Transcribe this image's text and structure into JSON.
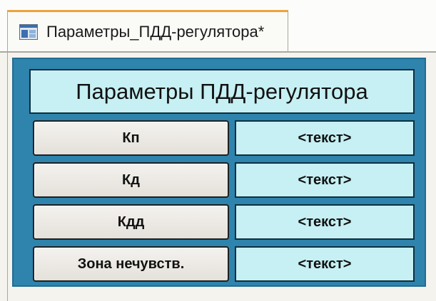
{
  "tab": {
    "title": "Параметры_ПДД-регулятора*",
    "icon": "screen-form-icon"
  },
  "panel": {
    "title": "Параметры ПДД-регулятора",
    "rows": [
      {
        "label": "Кп",
        "value": "<текст>"
      },
      {
        "label": "Кд",
        "value": "<текст>"
      },
      {
        "label": "Кдд",
        "value": "<текст>"
      },
      {
        "label": "Зона нечувств.",
        "value": "<текст>"
      }
    ]
  },
  "colors": {
    "panel_background": "#2e84ad",
    "field_background": "#c6f0f3",
    "tab_accent": "#f0a23a"
  }
}
